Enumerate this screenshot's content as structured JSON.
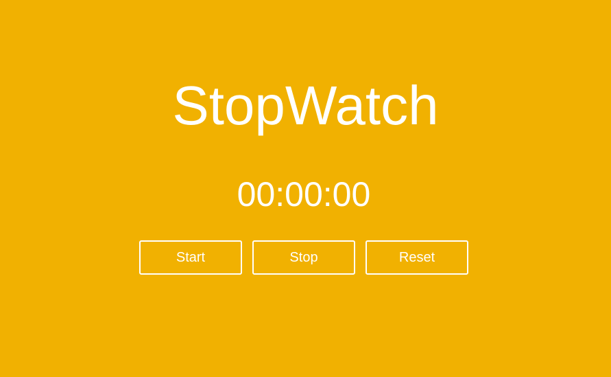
{
  "app": {
    "title": "StopWatch",
    "time_display": "00:00:00"
  },
  "controls": {
    "start_label": "Start",
    "stop_label": "Stop",
    "reset_label": "Reset"
  },
  "colors": {
    "background": "#F1B101",
    "foreground": "#FFFFFF"
  }
}
